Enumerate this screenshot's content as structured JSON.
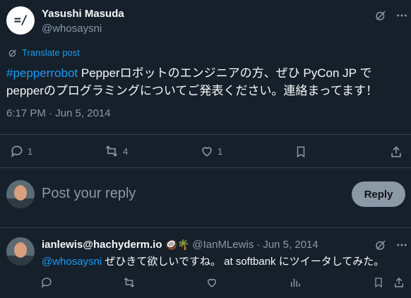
{
  "tweet": {
    "author_name": "Yasushi Masuda",
    "author_handle": "@whosaysni",
    "avatar_text": "=/",
    "translate_label": "Translate post",
    "hashtag": "#pepperrobot",
    "text_line1_rest": " Pepperロボットのエンジニアの方、ぜひ PyCon JP で",
    "text_line2": "pepperのプログラミングについてご発表ください。連絡まってます！",
    "timestamp": "6:17 PM · Jun 5, 2014",
    "reply_count": "1",
    "retweet_count": "4",
    "like_count": "1"
  },
  "composer": {
    "placeholder": "Post your reply",
    "reply_button": "Reply"
  },
  "reply": {
    "author_name": "ianlewis@hachyderm.io",
    "author_emojis": "🥥🌴",
    "author_handle": "@IanMLewis",
    "separator": "·",
    "date": "Jun 5, 2014",
    "mention": "@whosaysni",
    "text_rest": " ぜひきて欲しいですね。 at softbank にツイータしてみた。"
  },
  "colors": {
    "background": "#15202b",
    "accent": "#1d9bf0",
    "muted": "#8b98a5",
    "divider": "#38444d"
  }
}
